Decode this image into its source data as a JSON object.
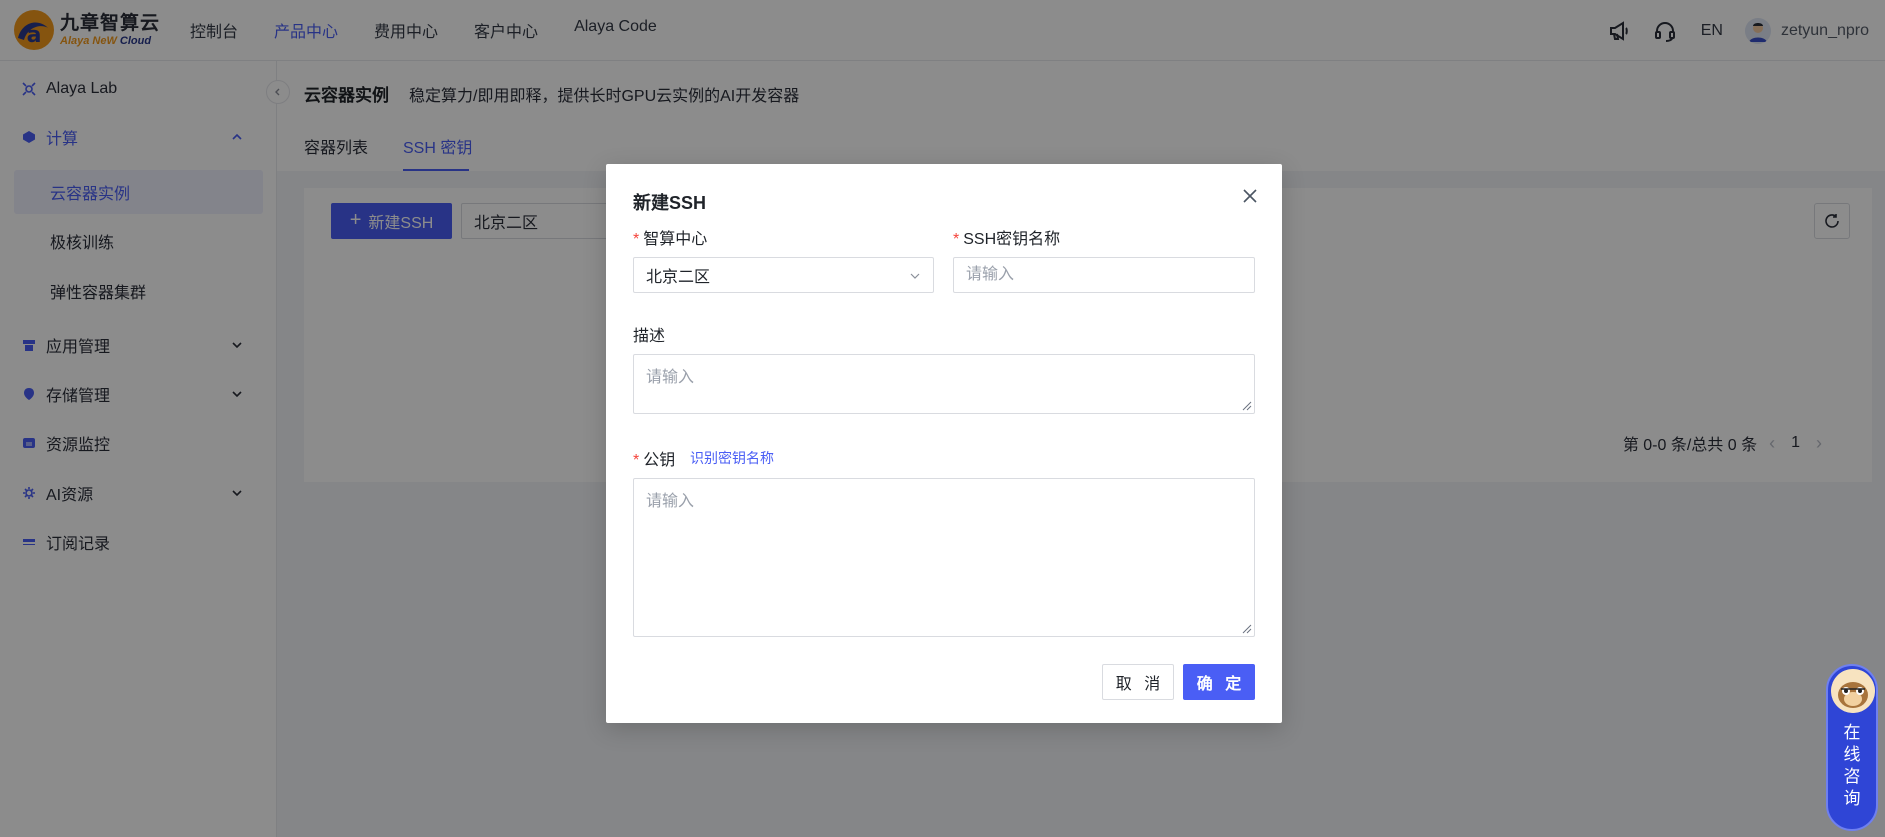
{
  "header": {
    "logo_cn": "九章智算云",
    "logo_en_a": "Alaya NeW",
    "logo_en_b": "Cloud",
    "nav": [
      "控制台",
      "产品中心",
      "费用中心",
      "客户中心",
      "Alaya Code"
    ],
    "active_nav": "产品中心",
    "lang": "EN",
    "username": "zetyun_npro",
    "icons": [
      "megaphone-icon",
      "headset-icon",
      "avatar"
    ]
  },
  "sidebar": {
    "items": [
      {
        "label": "Alaya Lab",
        "icon": "lab-icon"
      },
      {
        "label": "计算",
        "icon": "compute-icon",
        "expanded": true
      },
      {
        "label": "云容器实例",
        "sub": true,
        "active": true
      },
      {
        "label": "极核训练",
        "sub": true
      },
      {
        "label": "弹性容器集群",
        "sub": true
      },
      {
        "label": "应用管理",
        "icon": "app-icon",
        "expandable": true
      },
      {
        "label": "存储管理",
        "icon": "storage-icon",
        "expandable": true
      },
      {
        "label": "资源监控",
        "icon": "monitor-icon"
      },
      {
        "label": "AI资源",
        "icon": "ai-icon",
        "expandable": true
      },
      {
        "label": "订阅记录",
        "icon": "subscription-icon"
      }
    ]
  },
  "page": {
    "title": "云容器实例",
    "description": "稳定算力/即用即释，提供长时GPU云实例的AI开发容器",
    "tabs": [
      "容器列表",
      "SSH 密钥"
    ],
    "active_tab": "SSH 密钥",
    "new_button": "新建SSH",
    "region_filter": "北京二区",
    "pagination": {
      "summary": "第 0-0 条/总共 0 条",
      "current_page": "1"
    }
  },
  "modal": {
    "title": "新建SSH",
    "center_label": "智算中心",
    "center_value": "北京二区",
    "name_label": "SSH密钥名称",
    "name_placeholder": "请输入",
    "desc_label": "描述",
    "desc_placeholder": "请输入",
    "pubkey_label": "公钥",
    "pubkey_link": "识别密钥名称",
    "pubkey_placeholder": "请输入",
    "cancel": "取 消",
    "confirm": "确 定"
  },
  "chat": {
    "label_chars": [
      "在",
      "线",
      "咨",
      "询"
    ]
  },
  "colors": {
    "primary": "#4a5ef5",
    "required": "#f5443b",
    "chat_bg": "#2f45d6"
  }
}
